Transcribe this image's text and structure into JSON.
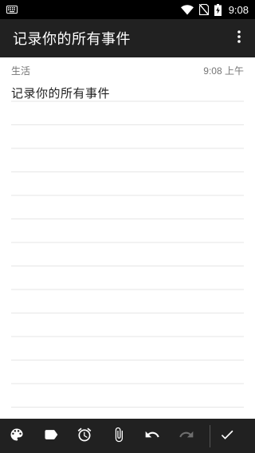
{
  "status_bar": {
    "time": "9:08",
    "icons": [
      "keyboard-icon",
      "wifi-icon",
      "no-sim-icon",
      "battery-charging-icon"
    ]
  },
  "app_bar": {
    "title": "记录你的所有事件",
    "menu_icon": "more-vert-icon"
  },
  "note": {
    "category": "生活",
    "time": "9:08 上午",
    "text": "记录你的所有事件"
  },
  "toolbar": {
    "tools": [
      "palette-icon",
      "label-icon",
      "alarm-icon",
      "attach-icon",
      "undo-icon",
      "redo-icon",
      "check-icon"
    ],
    "colors": {
      "enabled": "#ffffff",
      "disabled": "#6e6e6e",
      "background": "#212121"
    }
  }
}
